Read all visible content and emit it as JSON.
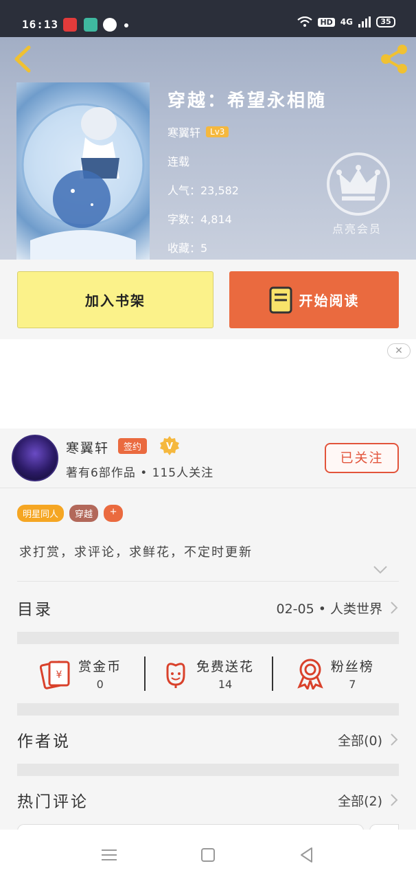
{
  "status_bar": {
    "time": "16:13",
    "network": "4G",
    "hd": "HD",
    "battery": "35"
  },
  "header": {
    "back_icon": "chevron-left-icon",
    "share_icon": "share-icon"
  },
  "book": {
    "title": "穿越：希望永相随",
    "author": "寒翼轩",
    "author_level": "Lv3",
    "status": "连载",
    "popularity": "人气：23,582",
    "word_count": "字数：4,814",
    "collections": "收藏：5"
  },
  "vip": {
    "label": "点亮会员",
    "icon": "crown-icon"
  },
  "actions": {
    "add_shelf": "加入书架",
    "start_reading": "开始阅读"
  },
  "ad": {
    "close_label": "✕"
  },
  "author_card": {
    "name": "寒翼轩",
    "sign_badge": "签约",
    "verified_label": "V",
    "stats": "著有6部作品 • 115人关注",
    "follow_label": "已关注"
  },
  "tags": [
    {
      "label": "明星同人",
      "color": "#f5a623"
    },
    {
      "label": "穿越",
      "color": "#b2685a"
    },
    {
      "label": "+",
      "color": "#ea6a3f"
    }
  ],
  "description": "求打赏，求评论，求鲜花，不定时更新",
  "catalog": {
    "title": "目录",
    "latest": "02-05  •  人类世界"
  },
  "rewards": [
    {
      "label": "赏金币",
      "count": "0",
      "icon": "red-envelope-icon"
    },
    {
      "label": "免费送花",
      "count": "14",
      "icon": "flower-icon"
    },
    {
      "label": "粉丝榜",
      "count": "7",
      "icon": "medal-icon"
    }
  ],
  "author_says": {
    "title": "作者说",
    "all_label": "全部(0)"
  },
  "hot_comments": {
    "title": "热门评论",
    "all_label": "全部(2)"
  },
  "colors": {
    "accent": "#ea6a3f",
    "shelf_button": "#fbf28a",
    "icon_red": "#d9412b"
  }
}
